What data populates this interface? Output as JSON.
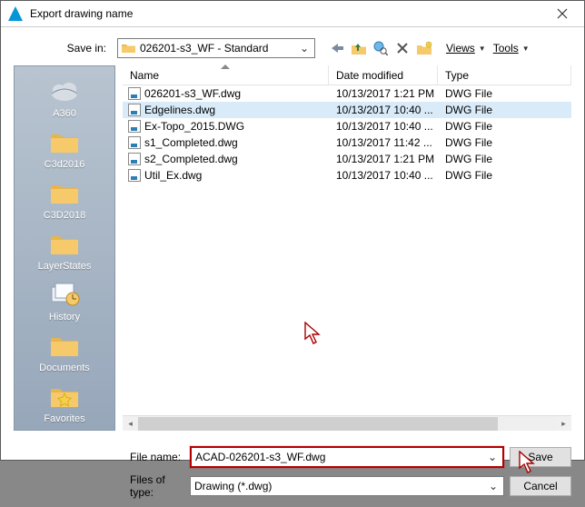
{
  "title": "Export drawing name",
  "toolbar": {
    "save_in_label": "Save in:",
    "save_in_value": "026201-s3_WF - Standard",
    "views_label": "Views",
    "tools_label": "Tools"
  },
  "columns": {
    "name": "Name",
    "date": "Date modified",
    "type": "Type"
  },
  "files": [
    {
      "name": "026201-s3_WF.dwg",
      "date": "10/13/2017 1:21 PM",
      "type": "DWG File"
    },
    {
      "name": "Edgelines.dwg",
      "date": "10/13/2017 10:40 ...",
      "type": "DWG File"
    },
    {
      "name": "Ex-Topo_2015.DWG",
      "date": "10/13/2017 10:40 ...",
      "type": "DWG File"
    },
    {
      "name": "s1_Completed.dwg",
      "date": "10/13/2017 11:42 ...",
      "type": "DWG File"
    },
    {
      "name": "s2_Completed.dwg",
      "date": "10/13/2017 1:21 PM",
      "type": "DWG File"
    },
    {
      "name": "Util_Ex.dwg",
      "date": "10/13/2017 10:40 ...",
      "type": "DWG File"
    }
  ],
  "selected_index": 1,
  "sidebar": {
    "items": [
      {
        "label": "A360"
      },
      {
        "label": "C3d2016"
      },
      {
        "label": "C3D2018"
      },
      {
        "label": "LayerStates"
      },
      {
        "label": "History"
      },
      {
        "label": "Documents"
      },
      {
        "label": "Favorites"
      }
    ]
  },
  "form": {
    "file_name_label": "File name:",
    "file_name_value": "ACAD-026201-s3_WF.dwg",
    "file_type_label": "Files of type:",
    "file_type_value": "Drawing (*.dwg)",
    "save_label": "Save",
    "cancel_label": "Cancel"
  }
}
